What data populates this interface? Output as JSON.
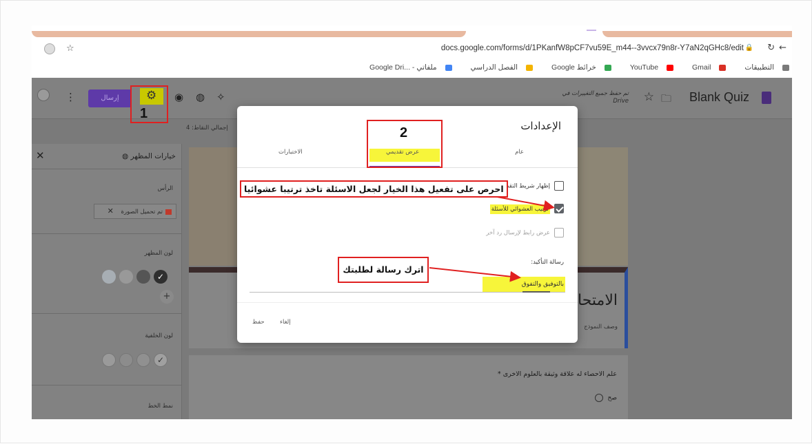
{
  "browser": {
    "url": "docs.google.com/forms/d/1PKanfW8pCF7vu59E_m44--3vvcx79n8r-Y7aN2qGHc8/edit",
    "bookmarks": [
      "التطبيقات",
      "Gmail",
      "YouTube",
      "خرائط Google",
      "الفصل الدراسي",
      "ملفاتي - ...Google Dri"
    ]
  },
  "header": {
    "title": "Blank Quiz",
    "saved_line1": "تم حفظ جميع التغييرات في",
    "saved_line2": "Drive",
    "send_label": "إرسال",
    "points": "إجمالي النقاط: 4"
  },
  "annotations": {
    "step1": "1",
    "step2": "2",
    "randomize_note": "احرص على تفعيل هذا الخيار لجعل الاسئلة تاخذ ترتيبا عشوائيا",
    "message_note": "اترك رسالة لطلبتك"
  },
  "theme_panel": {
    "title": "خيارات المظهر",
    "header_label": "الرأس",
    "image_uploaded": "تم تحميل الصورة",
    "theme_color_label": "لون المظهر",
    "background_color_label": "لون الخلفية",
    "font_style_label": "نمط الخط",
    "theme_colors": [
      "#a7aeb4",
      "#999999",
      "#555555",
      "#2f2f2f"
    ],
    "background_colors": [
      "#9a9a9a",
      "#8c8c8c",
      "#909090",
      "#a0a0a0"
    ]
  },
  "form": {
    "title": "الامتحا",
    "description": "وصف النموذج",
    "question": "علم الاحصاء له علاقة وثيقة بالعلوم الاخرى *",
    "option": "صح"
  },
  "settings": {
    "title": "الإعدادات",
    "tabs": [
      "عام",
      "عرض تقديمي",
      "الاختبارات"
    ],
    "show_progress": "إظهار شريط التقدم",
    "shuffle_questions": "ترتيب العشوائي للأسئلة",
    "show_link": "عرض رابط لإرسال رد آخر",
    "confirmation_label": "رسالة التأكيد:",
    "confirmation_value": "بالتوفيق والتفوق",
    "cancel_label": "إلغاء",
    "save_label": "حفظ"
  },
  "colors": {
    "accent": "#673ab7",
    "highlight": "#f7f53a",
    "annotation_red": "#e02020"
  }
}
